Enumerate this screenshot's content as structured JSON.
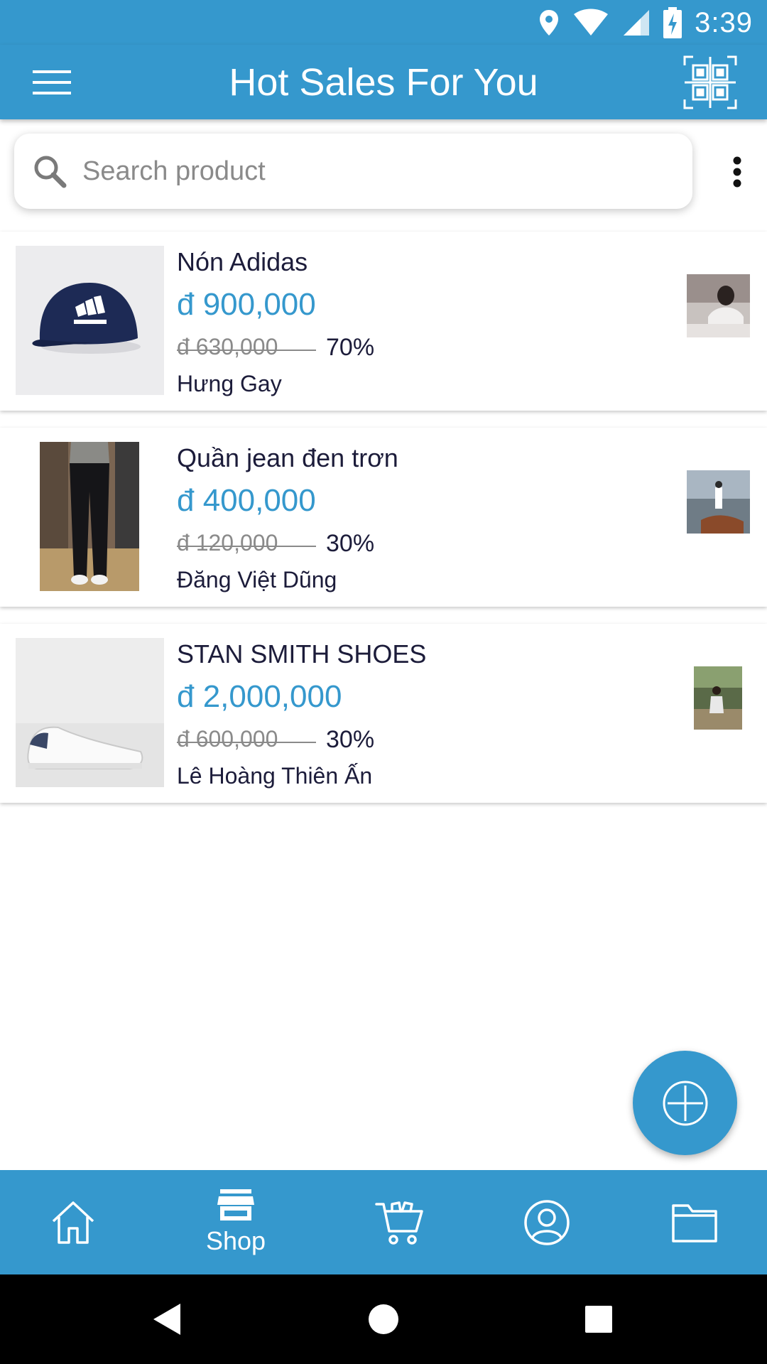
{
  "status_bar": {
    "time": "3:39"
  },
  "app_bar": {
    "title": "Hot Sales For You"
  },
  "search": {
    "placeholder": "Search product",
    "value": ""
  },
  "products": [
    {
      "name": "Nón Adidas",
      "price": "đ 900,000",
      "old_price": "đ 630,000",
      "discount": "70%",
      "seller": "Hưng Gay"
    },
    {
      "name": "Quần jean đen trơn",
      "price": "đ 400,000",
      "old_price": "đ 120,000",
      "discount": "30%",
      "seller": "Đăng Việt Dũng"
    },
    {
      "name": "STAN SMITH SHOES",
      "price": "đ 2,000,000",
      "old_price": "đ 600,000",
      "discount": "30%",
      "seller": "Lê Hoàng Thiên Ấn"
    }
  ],
  "bottom_nav": {
    "items": [
      {
        "id": "home",
        "label": "",
        "icon": "home-icon"
      },
      {
        "id": "shop",
        "label": "Shop",
        "icon": "store-icon",
        "active": true
      },
      {
        "id": "cart",
        "label": "",
        "icon": "cart-icon"
      },
      {
        "id": "profile",
        "label": "",
        "icon": "user-icon"
      },
      {
        "id": "files",
        "label": "",
        "icon": "folder-icon"
      }
    ]
  },
  "colors": {
    "primary": "#3598cd",
    "text": "#1c1c3a",
    "muted": "#8a8a8a"
  }
}
